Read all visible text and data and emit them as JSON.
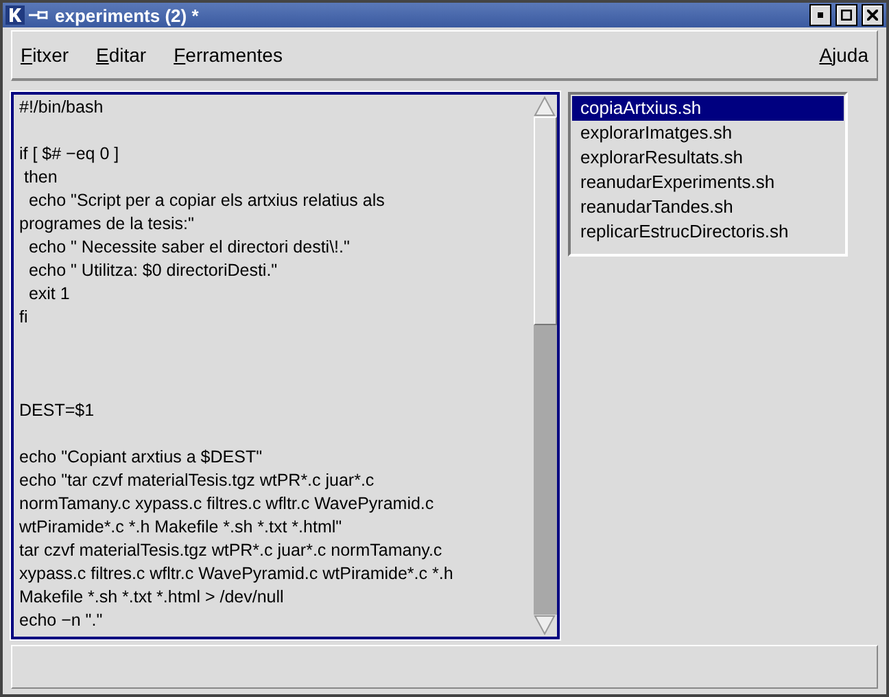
{
  "window": {
    "title": "experiments (2) *"
  },
  "menu": [
    {
      "label": "Fitxer"
    },
    {
      "label": "Editar"
    },
    {
      "label": "Ferramentes"
    },
    {
      "label": "Ajuda"
    }
  ],
  "editor": {
    "lines": [
      {
        "kind": "text",
        "text": "#!/bin/bash"
      },
      {
        "kind": "blank"
      },
      {
        "kind": "text",
        "text": "if [ $# −eq 0 ]"
      },
      {
        "kind": "text",
        "text": " then"
      },
      {
        "kind": "text",
        "text": "  echo \"Script per a copiar els artxius relatius als"
      },
      {
        "kind": "text",
        "text": "programes de la tesis:\""
      },
      {
        "kind": "text",
        "text": "  echo \" Necessite saber el directori desti\\!.\""
      },
      {
        "kind": "text",
        "text": "  echo \" Utilitza: $0 directoriDesti.\""
      },
      {
        "kind": "text",
        "text": "  exit 1"
      },
      {
        "kind": "text",
        "text": "fi"
      },
      {
        "kind": "blank"
      },
      {
        "kind": "blank"
      },
      {
        "kind": "blank"
      },
      {
        "kind": "text",
        "text": "DEST=$1"
      },
      {
        "kind": "blank"
      },
      {
        "kind": "text",
        "text": "echo \"Copiant arxtius a $DEST\""
      },
      {
        "kind": "text",
        "text": "echo \"tar czvf materialTesis.tgz wtPR*.c juar*.c"
      },
      {
        "kind": "text",
        "text": "normTamany.c xypass.c filtres.c wfltr.c WavePyramid.c"
      },
      {
        "kind": "text",
        "text": "wtPiramide*.c *.h Makefile *.sh *.txt *.html\""
      },
      {
        "kind": "text",
        "text": "tar czvf materialTesis.tgz wtPR*.c juar*.c normTamany.c"
      },
      {
        "kind": "text",
        "text": "xypass.c filtres.c wfltr.c WavePyramid.c wtPiramide*.c *.h"
      },
      {
        "kind": "text",
        "text": "Makefile *.sh *.txt *.html > /dev/null"
      },
      {
        "kind": "text",
        "text": "echo −n \".\""
      }
    ]
  },
  "files": [
    {
      "name": "copiaArtxius.sh",
      "selected": true
    },
    {
      "name": "explorarImatges.sh",
      "selected": false
    },
    {
      "name": "explorarResultats.sh",
      "selected": false
    },
    {
      "name": "reanudarExperiments.sh",
      "selected": false
    },
    {
      "name": "reanudarTandes.sh",
      "selected": false
    },
    {
      "name": "replicarEstrucDirectoris.sh",
      "selected": false
    }
  ]
}
